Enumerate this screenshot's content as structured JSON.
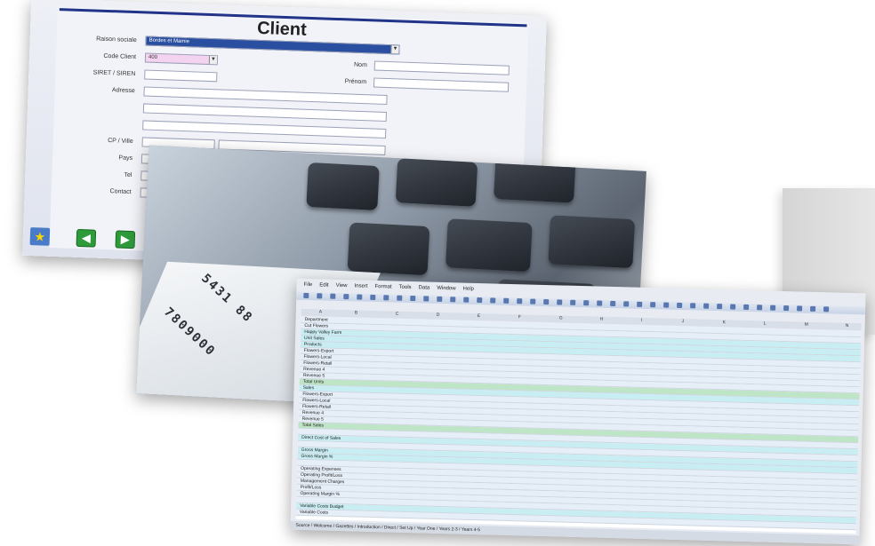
{
  "client_form": {
    "title": "Client",
    "fields": {
      "raison_sociale_label": "Raison sociale",
      "raison_sociale_value": "Bordes et Mamie",
      "code_client_label": "Code Client",
      "code_client_value": "400",
      "nom_label": "Nom",
      "siret_label": "SIRET / SIREN",
      "prenom_label": "Prénom",
      "adresse_label": "Adresse",
      "cp_ville_label": "CP / Ville",
      "pays_label": "Pays",
      "tel_label": "Tel",
      "contact_label": "Contact"
    },
    "nav": {
      "prev_icon": "◀",
      "next_icon": "▶",
      "star_icon": "★"
    }
  },
  "photo": {
    "digits_line1": "5431 88",
    "digits_line2": "7809000"
  },
  "spreadsheet": {
    "menu": [
      "File",
      "Edit",
      "View",
      "Insert",
      "Format",
      "Tools",
      "Data",
      "Window",
      "Help"
    ],
    "columns": [
      "A",
      "B",
      "C",
      "D",
      "E",
      "F",
      "G",
      "H",
      "I",
      "J",
      "K",
      "L",
      "M",
      "N"
    ],
    "header_title": "Happy Valley Farm",
    "rows": [
      {
        "label": "Department",
        "type": "b"
      },
      {
        "label": "Cut Flowers",
        "type": "b"
      },
      {
        "label": "Happy Valley Farm",
        "type": "c"
      },
      {
        "label": "Unit Sales",
        "type": "c"
      },
      {
        "label": "Products",
        "type": "c"
      },
      {
        "label": "Flowers-Export",
        "type": "b"
      },
      {
        "label": "Flowers-Local",
        "type": "b"
      },
      {
        "label": "Flowers-Retail",
        "type": "b"
      },
      {
        "label": "Revenue 4",
        "type": "b"
      },
      {
        "label": "Revenue 5",
        "type": "b"
      },
      {
        "label": "Total Units",
        "type": "g"
      },
      {
        "label": "Sales",
        "type": "c"
      },
      {
        "label": "Flowers-Export",
        "type": "b"
      },
      {
        "label": "Flowers-Local",
        "type": "b"
      },
      {
        "label": "Flowers-Retail",
        "type": "b"
      },
      {
        "label": "Revenue 4",
        "type": "b"
      },
      {
        "label": "Revenue 5",
        "type": "b"
      },
      {
        "label": "Total Sales",
        "type": "g"
      },
      {
        "label": "",
        "type": "b"
      },
      {
        "label": "Direct Cost of Sales",
        "type": "c"
      },
      {
        "label": "",
        "type": "b"
      },
      {
        "label": "Gross Margin",
        "type": "c"
      },
      {
        "label": "Gross Margin %",
        "type": "c"
      },
      {
        "label": "",
        "type": "b"
      },
      {
        "label": "Operating Expenses",
        "type": "b"
      },
      {
        "label": "Operating Profit/Loss",
        "type": "b"
      },
      {
        "label": "Management Charges",
        "type": "b"
      },
      {
        "label": "Profit/Loss",
        "type": "b"
      },
      {
        "label": "Operating Margin %",
        "type": "b"
      },
      {
        "label": "",
        "type": "b"
      },
      {
        "label": "Variable Costs Budget",
        "type": "c"
      },
      {
        "label": "Variable Costs",
        "type": "b"
      }
    ],
    "tabs": "Source / Welcome / Gazettes / Introduction / Direct / Set Up / Year One / Years 2-3 / Years 4-5"
  }
}
